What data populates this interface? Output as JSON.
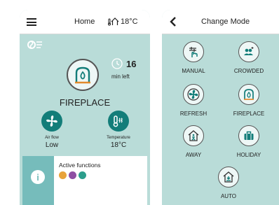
{
  "left_screen": {
    "header": {
      "title": "Home",
      "temperature": "18°C"
    },
    "current_mode": {
      "name": "FIREPLACE",
      "timer_value": "16",
      "timer_unit": "min left"
    },
    "stats": {
      "airflow": {
        "label": "Air flow",
        "value": "Low"
      },
      "temperature": {
        "label": "Temperature",
        "value": "18°C"
      }
    },
    "active_functions": {
      "title": "Active functions",
      "icon_colors": [
        "#e8a33a",
        "#8e4fa3",
        "#2c9e8c"
      ]
    }
  },
  "right_screen": {
    "header": {
      "title": "Change Mode"
    },
    "modes": [
      {
        "label": "MANUAL",
        "icon": "manual-hand-icon"
      },
      {
        "label": "CROWDED",
        "icon": "crowded-people-icon"
      },
      {
        "label": "REFRESH",
        "icon": "refresh-fan-icon"
      },
      {
        "label": "FIREPLACE",
        "icon": "fireplace-icon"
      },
      {
        "label": "AWAY",
        "icon": "away-house-icon"
      },
      {
        "label": "HOLIDAY",
        "icon": "holiday-suitcase-icon"
      },
      {
        "label": "AUTO",
        "icon": "auto-house-icon"
      }
    ]
  },
  "colors": {
    "background": "#b9dcd8",
    "accent": "#137d79",
    "card_side": "#76bcbb"
  }
}
